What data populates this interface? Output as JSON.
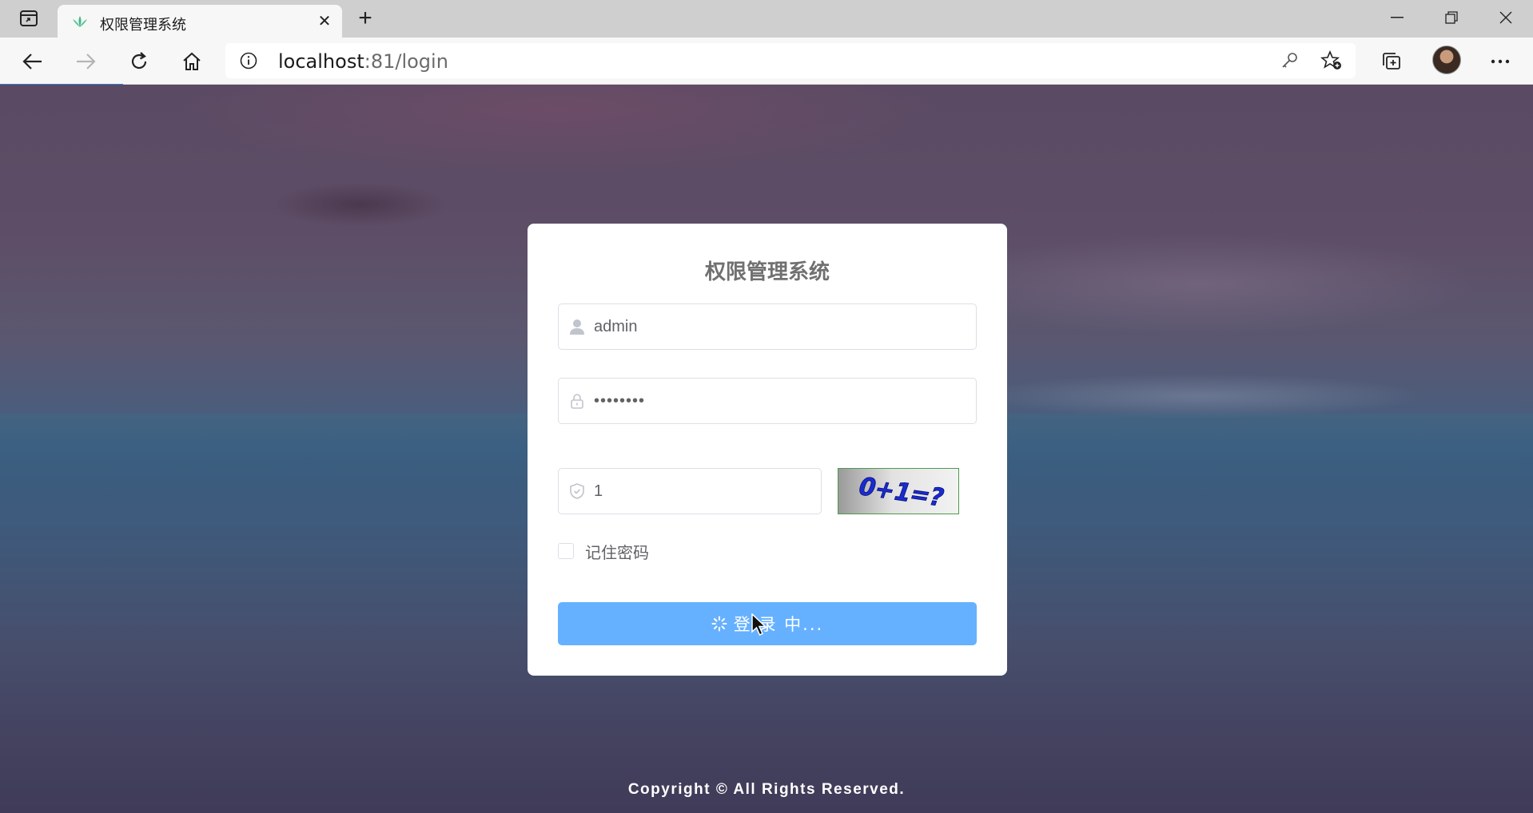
{
  "browser": {
    "tab_title": "权限管理系统",
    "url_host": "localhost",
    "url_port_path": ":81/login",
    "icons": [
      "tab-actions-icon",
      "leaf-favicon-icon",
      "close-icon",
      "plus-icon",
      "minimize-icon",
      "restore-icon",
      "window-close-icon",
      "back-icon",
      "forward-icon",
      "refresh-icon",
      "home-icon",
      "info-icon",
      "key-icon",
      "favorite-add-icon",
      "collections-icon",
      "more-icon"
    ]
  },
  "login": {
    "title": "权限管理系统",
    "username": "admin",
    "password": "••••••••",
    "captcha_value": "1",
    "captcha_image_text": "0+1=?",
    "remember_label": "记住密码",
    "remember_checked": false,
    "button_label": "登 录 中..."
  },
  "footer": {
    "copyright": "Copyright © All Rights Reserved."
  },
  "colors": {
    "button": "#66b1ff",
    "card": "#ffffff",
    "title": "#707070"
  }
}
